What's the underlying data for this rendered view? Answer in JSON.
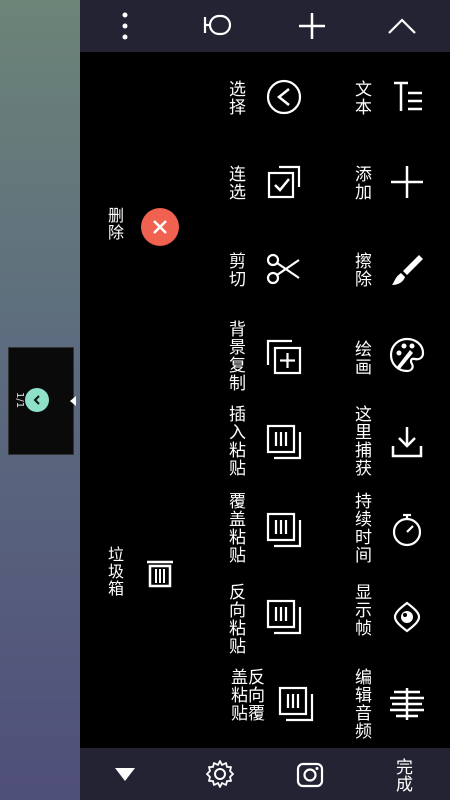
{
  "thumbnail": {
    "page": "1/1"
  },
  "toolbar": {},
  "side_actions": {
    "delete": "删除",
    "trash": "垃圾箱"
  },
  "grid": {
    "right_col": [
      "文本",
      "添加",
      "擦除",
      "绘画",
      "这里捕获",
      "持续时间",
      "显示帧",
      "编辑音频"
    ],
    "left_col": [
      "选择",
      "连选",
      "剪切",
      "背景复制",
      "插入粘贴",
      "覆盖粘贴",
      "反向粘贴",
      "反向覆盖粘贴"
    ]
  },
  "bottom": {
    "done": "完成"
  },
  "colors": {
    "delete_button": "#f0614f",
    "toolbar_bg": "#232334",
    "check": "#8ee0c8"
  }
}
